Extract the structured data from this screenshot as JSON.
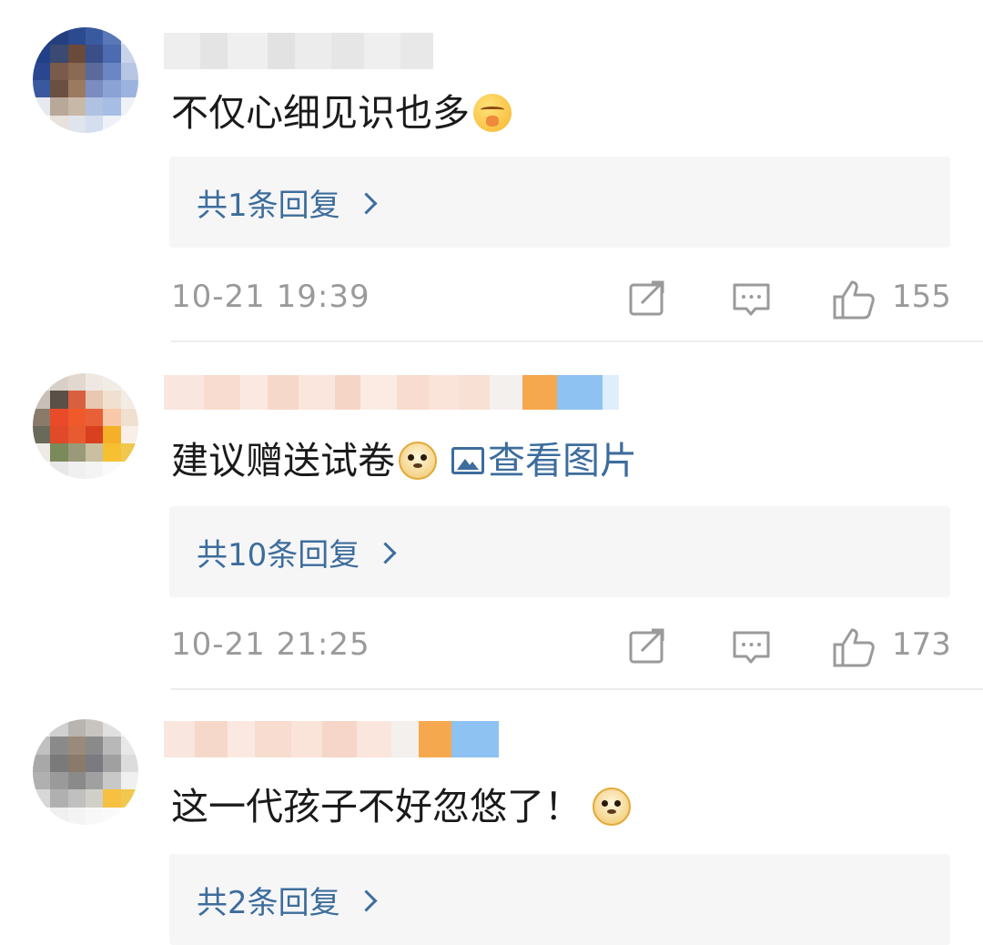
{
  "comments": [
    {
      "content": "不仅心细见识也多",
      "emoji": "shushing-face-emoji",
      "replies_label": "共1条回复",
      "time": "10-21 19:39",
      "likes": "155"
    },
    {
      "content": "建议赠送试卷",
      "emoji": "doge-emoji",
      "view_image_label": "查看图片",
      "replies_label": "共10条回复",
      "time": "10-21 21:25",
      "likes": "173"
    },
    {
      "content": "这一代孩子不好忽悠了！",
      "emoji": "doge-emoji",
      "replies_label": "共2条回复"
    }
  ],
  "colors": {
    "link": "#3d6d9c",
    "meta": "#9a9a9a",
    "reply_bg": "#f6f6f7",
    "text": "#1a1a1a"
  },
  "icons": {
    "share": "share-icon",
    "comment": "comment-icon",
    "like": "thumbs-up-icon",
    "chevron": "chevron-right-icon",
    "image": "image-icon"
  }
}
